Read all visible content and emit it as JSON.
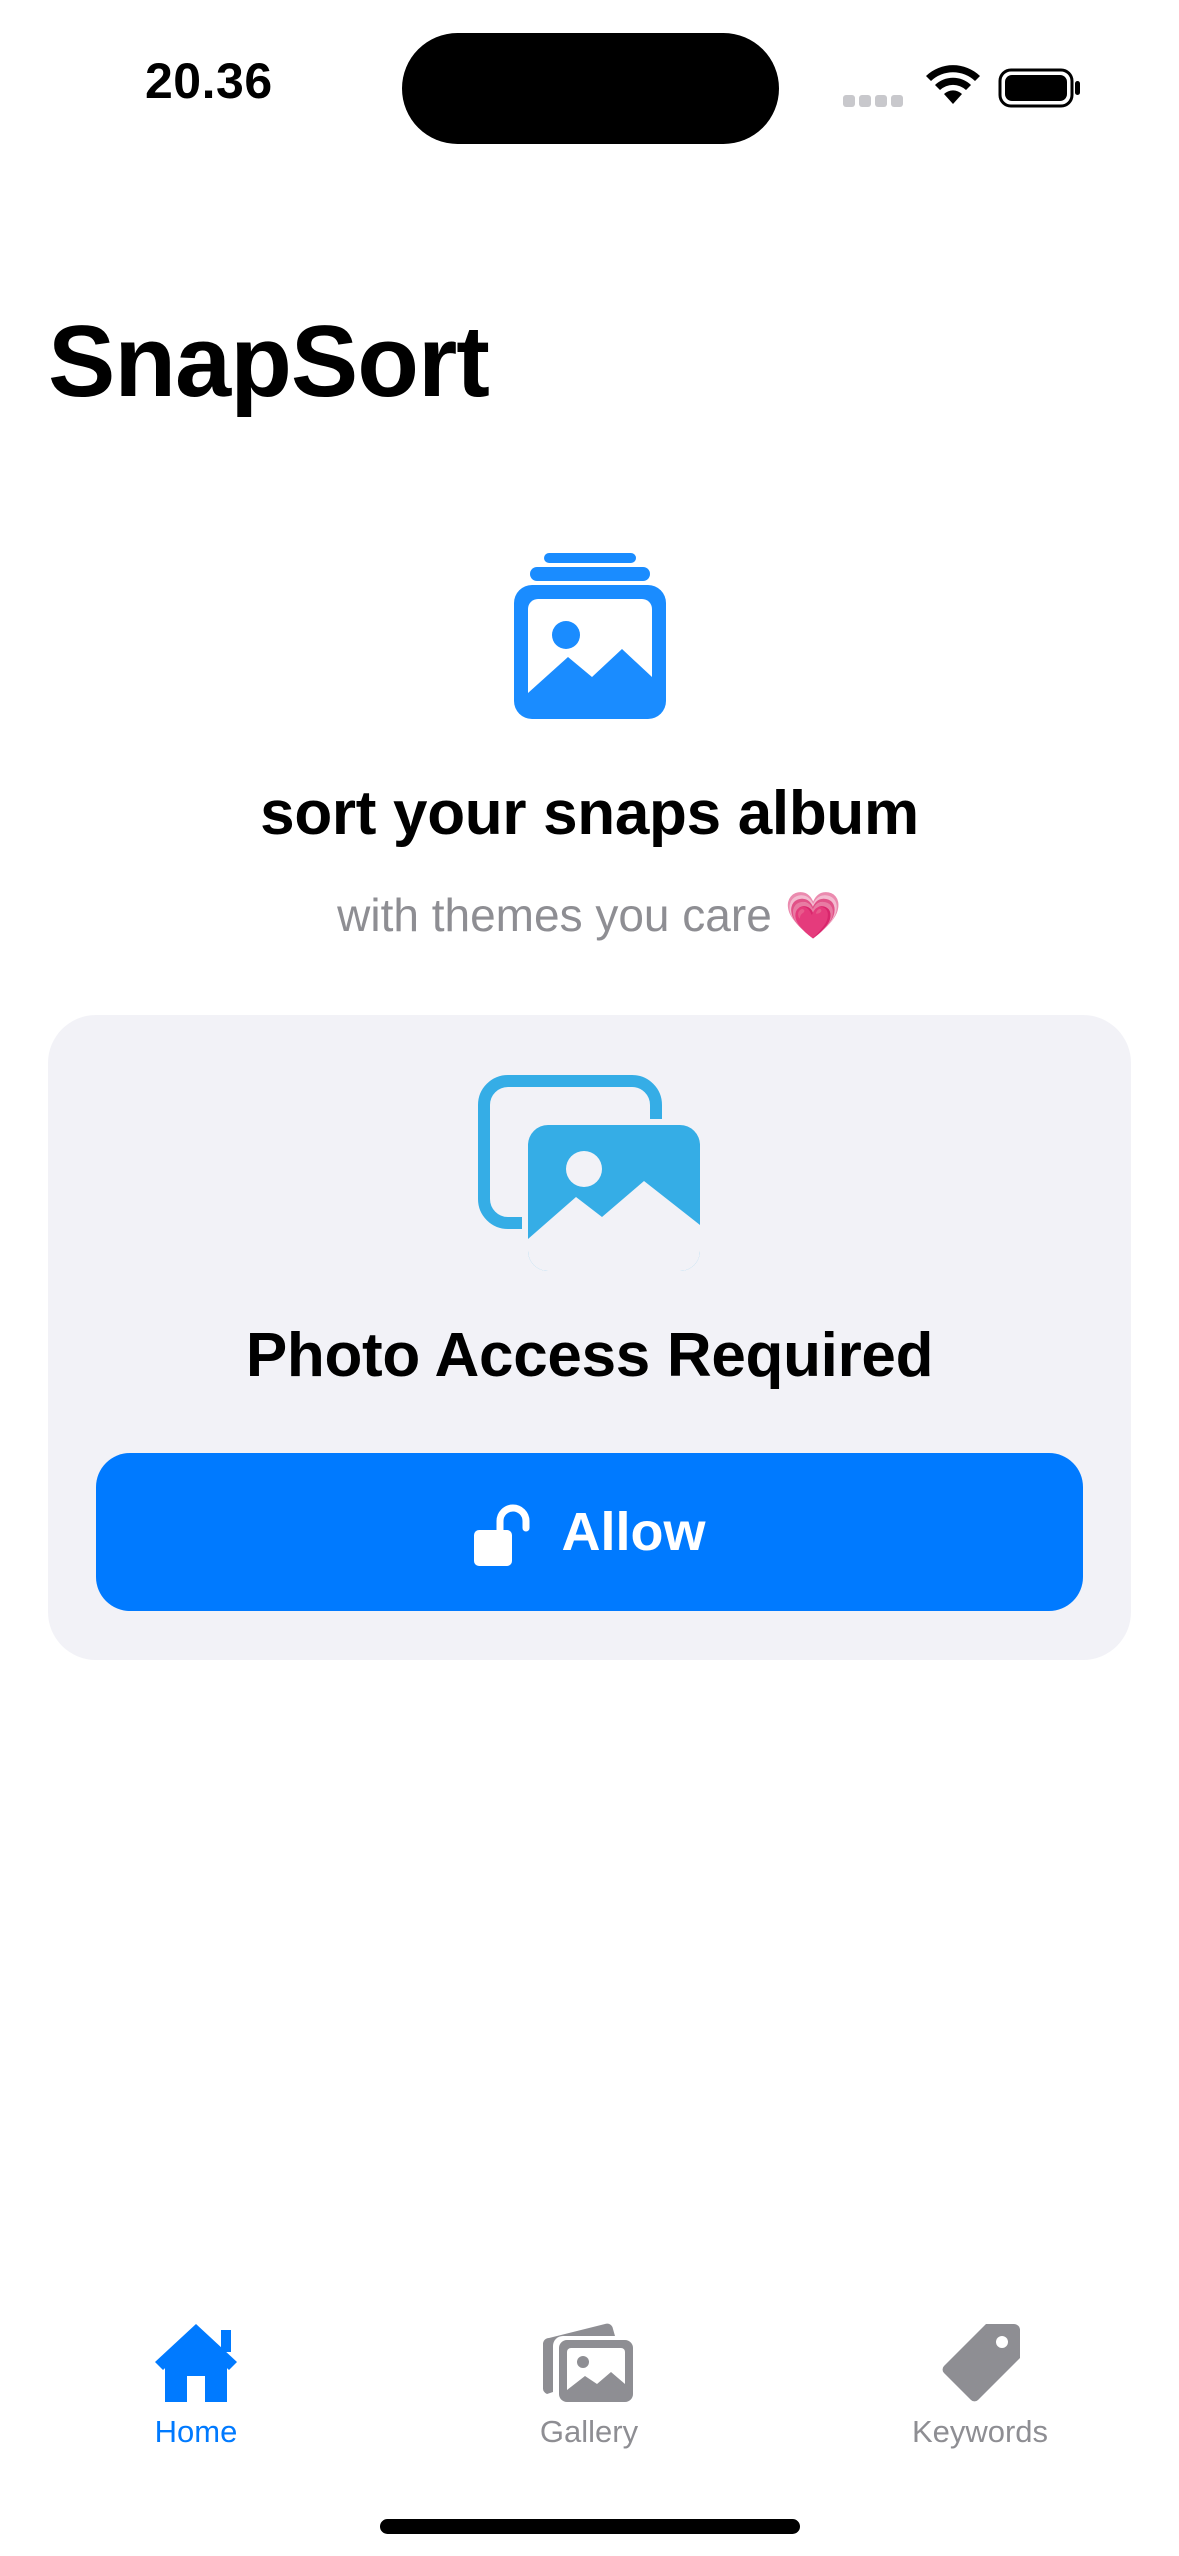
{
  "status_bar": {
    "time": "20.36",
    "wifi_icon": "wifi-icon",
    "battery_icon": "battery-icon"
  },
  "app": {
    "title": "SnapSort"
  },
  "hero": {
    "icon": "photo-stack-icon",
    "title": "sort your snaps album",
    "subtitle": "with themes you care",
    "subtitle_emoji": "💗"
  },
  "permission_card": {
    "icon": "photos-icon",
    "title": "Photo Access Required",
    "button_label": "Allow",
    "button_icon": "lock-open-icon"
  },
  "tab_bar": {
    "tabs": [
      {
        "label": "Home",
        "icon": "house-icon",
        "selected": true
      },
      {
        "label": "Gallery",
        "icon": "photo-stack-icon",
        "selected": false
      },
      {
        "label": "Keywords",
        "icon": "tag-icon",
        "selected": false
      }
    ]
  },
  "colors": {
    "accent": "#007aff",
    "hero_icon": "#1a8cff",
    "photos_icon": "#35ade6",
    "card_background": "#f2f2f7",
    "secondary_text": "#8e8e93"
  }
}
